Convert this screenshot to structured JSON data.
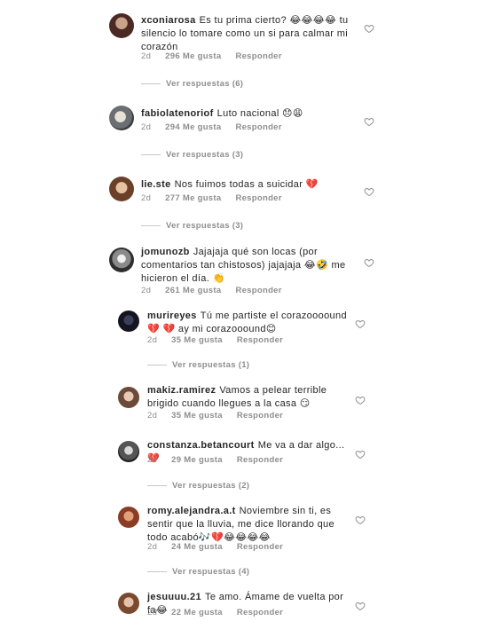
{
  "comments": [
    {
      "username": "xconiarosa",
      "text": "Es tu prima cierto? 😂😂😂😂 tu silencio lo tomare como un si para calmar mi corazón",
      "age": "2d",
      "likes": "296 Me gusta",
      "reply_label": "Responder",
      "view_replies": "Ver respuestas (6)"
    },
    {
      "username": "fabiolatenoriof",
      "text": "Luto nacional 😞😩",
      "age": "2d",
      "likes": "294 Me gusta",
      "reply_label": "Responder",
      "view_replies": "Ver respuestas (3)"
    },
    {
      "username": "lie.ste",
      "text": "Nos fuimos todas a suicidar 💔",
      "age": "2d",
      "likes": "277 Me gusta",
      "reply_label": "Responder",
      "view_replies": "Ver respuestas (3)"
    },
    {
      "username": "jomunozb",
      "text": "Jajajaja qué son locas (por comentarios tan chistosos) jajajaja 😂🤣 me hicieron el día. 👏",
      "age": "2d",
      "likes": "261 Me gusta",
      "reply_label": "Responder"
    },
    {
      "username": "murireyes",
      "text": "Tú me partiste el corazoooound💔 💔 ay mi corazooound😊",
      "age": "2d",
      "likes": "35 Me gusta",
      "reply_label": "Responder",
      "view_replies": "Ver respuestas (1)"
    },
    {
      "username": "makiz.ramirez",
      "text": "Vamos a pelear terrible brigido cuando llegues a la casa 😏",
      "age": "2d",
      "likes": "35 Me gusta",
      "reply_label": "Responder"
    },
    {
      "username": "constanza.betancourt",
      "text": "Me va a dar algo... 💔",
      "age": "2d",
      "likes": "29 Me gusta",
      "reply_label": "Responder",
      "view_replies": "Ver respuestas (2)"
    },
    {
      "username": "romy.alejandra.a.t",
      "text": "Noviembre sin ti, es sentir que la lluvia, me dice llorando que todo acabó🎶💔😂😂😂😂",
      "age": "2d",
      "likes": "24 Me gusta",
      "reply_label": "Responder",
      "view_replies": "Ver respuestas (4)"
    },
    {
      "username": "jesuuuu.21",
      "text": "Te amo. Ámame de vuelta por fa😂",
      "age": "2d",
      "likes": "22 Me gusta",
      "reply_label": "Responder"
    }
  ],
  "colors": {
    "text": "#262626",
    "secondary": "#8e8e8e",
    "divider": "#c7c7c7"
  },
  "icons": {
    "like": "heart-outline-icon"
  }
}
